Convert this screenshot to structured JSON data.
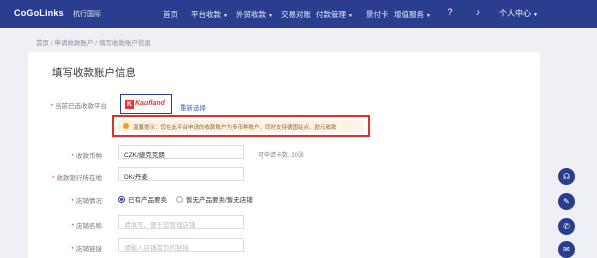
{
  "header": {
    "logo": "CoGoLinks",
    "logo_sub": "杭行国际",
    "nav": [
      {
        "label": "首页"
      },
      {
        "label": "平台收款"
      },
      {
        "label": "外贸收款"
      },
      {
        "label": "交易对账"
      },
      {
        "label": "付款管理"
      },
      {
        "label": "景付卡"
      },
      {
        "label": "增值服务"
      }
    ],
    "help_icon": "question-circle-icon",
    "bell_icon": "bell-icon",
    "user_menu": "个人中心"
  },
  "breadcrumb": "首页 / 申请收款账户 / 填写收款账户信息",
  "page_title": "填写收款账户信息",
  "form": {
    "platform_label": "当前已选收款平台",
    "platform_name": "Kaufland",
    "reselect": "重新选择",
    "tip": "温馨提示：您在此平台申请的收款账户为多币种账户，同时支持德国站点、欧元收款",
    "currency_label": "收款币种",
    "currency_value": "CZK/捷克克朗",
    "currency_hint": "可申请卡数: 20张",
    "country_label": "收款银行所在地",
    "country_value": "DK/丹麦",
    "store_status_label": "店铺情况",
    "store_option_1": "已有产品要卖",
    "store_option_2": "暂无产品要卖/暂无店铺",
    "store_name_label": "店铺名称",
    "store_name_placeholder": "请填写，便于您管理店铺",
    "store_link_label": "店铺链接",
    "store_link_placeholder": "请输入店铺首页的链接"
  },
  "float_icons": [
    "headset-icon",
    "feedback-icon",
    "phone-icon",
    "mail-icon"
  ]
}
